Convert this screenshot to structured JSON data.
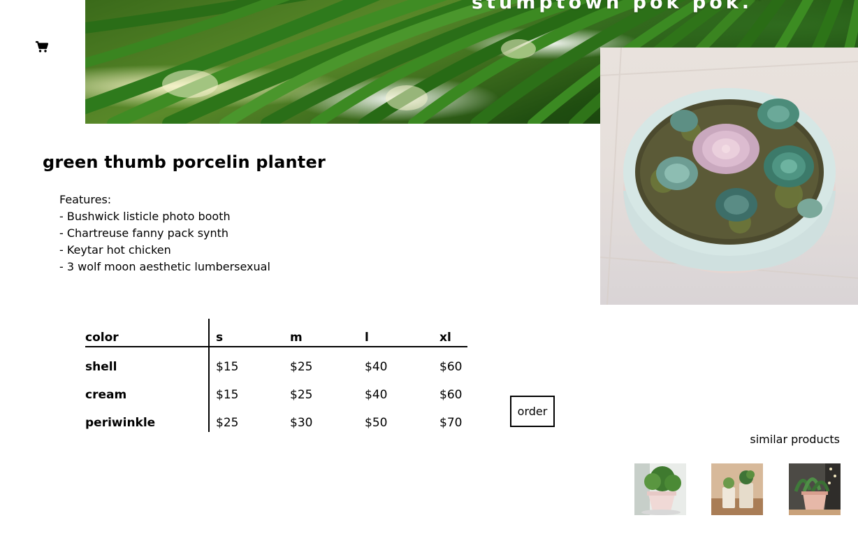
{
  "hero": {
    "quote": "stumptown pok pok.\""
  },
  "product": {
    "title": "green thumb porcelin planter",
    "features_heading": "Features:",
    "features": [
      "- Bushwick listicle photo booth",
      "- Chartreuse fanny pack synth",
      "- Keytar hot chicken",
      "- 3 wolf moon aesthetic lumbersexual"
    ]
  },
  "pricing": {
    "headers": [
      "color",
      "s",
      "m",
      "l",
      "xl"
    ],
    "rows": [
      {
        "color": "shell",
        "prices": [
          "$15",
          "$25",
          "$40",
          "$60"
        ]
      },
      {
        "color": "cream",
        "prices": [
          "$15",
          "$25",
          "$40",
          "$60"
        ]
      },
      {
        "color": "periwinkle",
        "prices": [
          "$25",
          "$30",
          "$50",
          "$70"
        ]
      }
    ]
  },
  "actions": {
    "order_label": "order"
  },
  "similar": {
    "label": "similar products"
  },
  "icons": {
    "cart": "shopping-cart-icon"
  }
}
